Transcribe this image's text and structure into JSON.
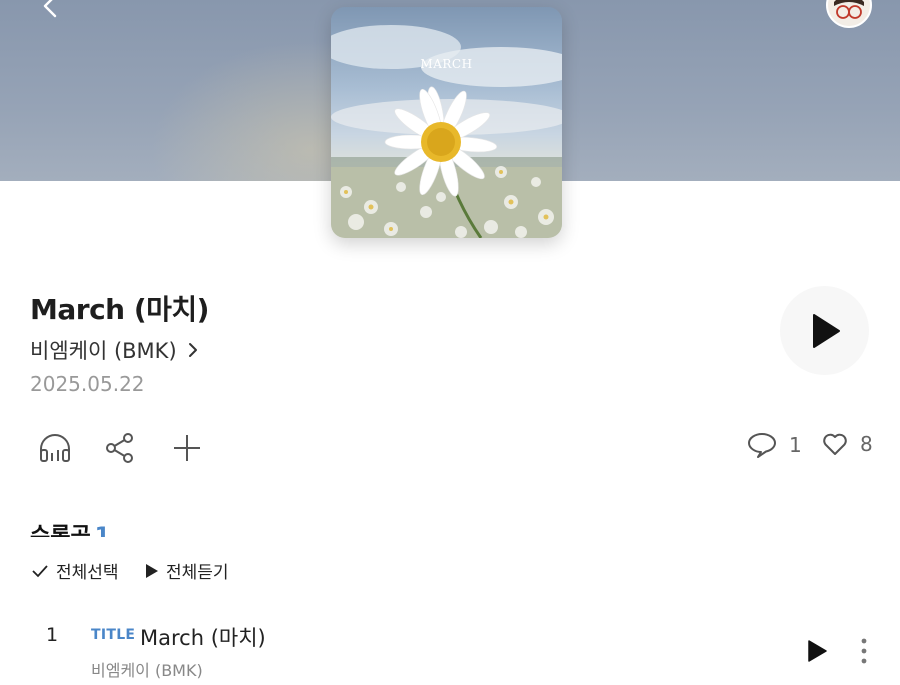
{
  "header": {
    "back_icon": "chevron-left-icon",
    "avatar_icon": "profile-avatar-icon"
  },
  "album": {
    "cover_text": "MARCH",
    "title": "March (마치)",
    "artist": "비엠케이 (BMK)",
    "release_date": "2025.05.22"
  },
  "actions": {
    "icons": [
      "headphones-icon",
      "share-icon",
      "add-icon"
    ],
    "comments_count": "1",
    "likes_count": "8"
  },
  "tracklist": {
    "section_title": "수록곡",
    "section_count": "1",
    "select_all_label": "전체선택",
    "play_all_label": "전체듣기",
    "tracks": [
      {
        "number": "1",
        "badge": "TITLE",
        "title": "March (마치)",
        "artist": "비엠케이 (BMK)"
      }
    ]
  },
  "colors": {
    "accent": "#4a86c8",
    "hero_bg": "#8f9db2"
  }
}
